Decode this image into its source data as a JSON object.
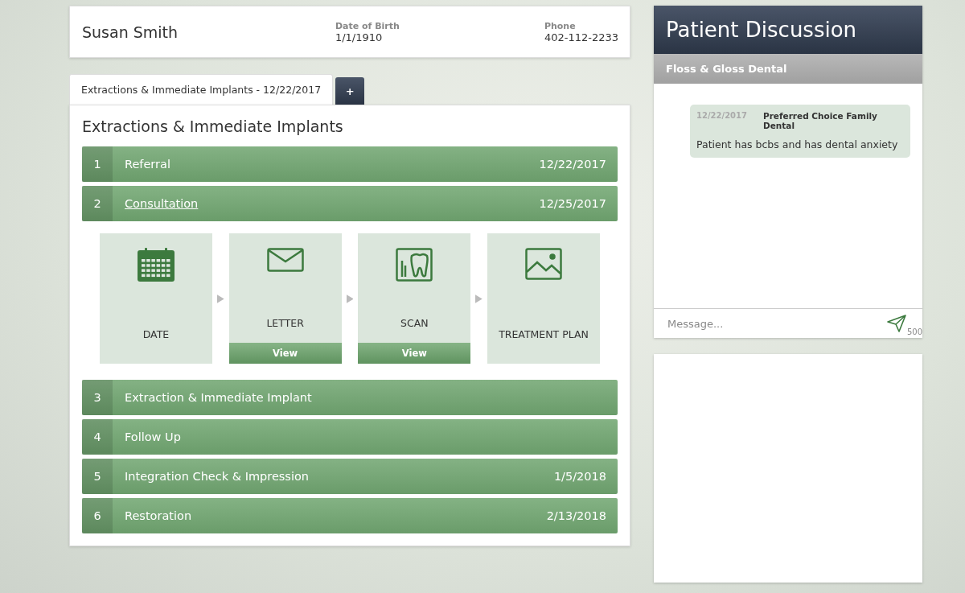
{
  "patient": {
    "name": "Susan Smith",
    "fields": [
      {
        "label": "Date of Birth",
        "value": "1/1/1910"
      },
      {
        "label": "Phone",
        "value": "402-112-2233"
      }
    ]
  },
  "tabs": [
    {
      "label": "Extractions & Immediate Implants - 12/22/2017",
      "selected": true
    },
    {
      "label": "+",
      "selected": false
    }
  ],
  "plan": {
    "title": "Extractions & Immediate Implants",
    "steps": [
      {
        "number": "1",
        "title": "Referral",
        "date": "12/22/2017",
        "expanded": false
      },
      {
        "number": "2",
        "title": "Consultation",
        "date": "12/25/2017",
        "expanded": true,
        "cards": [
          {
            "kind": "calendar",
            "label": "DATE"
          },
          {
            "kind": "envelope",
            "label": "LETTER",
            "action": "View"
          },
          {
            "kind": "scan",
            "label": "SCAN",
            "action": "View"
          },
          {
            "kind": "image",
            "label": "TREATMENT PLAN"
          }
        ]
      },
      {
        "number": "3",
        "title": "Extraction & Immediate Implant",
        "expanded": false
      },
      {
        "number": "4",
        "title": "Follow Up",
        "expanded": false
      },
      {
        "number": "5",
        "title": "Integration Check & Impression",
        "date": "1/5/2018",
        "expanded": false
      },
      {
        "number": "6",
        "title": "Restoration",
        "date": "2/13/2018",
        "expanded": false
      }
    ]
  },
  "discussion": {
    "title": "Patient Discussion",
    "practice": "Floss & Gloss Dental",
    "messages": [
      {
        "date": "12/22/2017",
        "author": "Preferred Choice Family Dental",
        "text": "Patient has bcbs and has dental anxiety"
      }
    ],
    "input": {
      "placeholder": "Message...",
      "counter": "500"
    }
  }
}
